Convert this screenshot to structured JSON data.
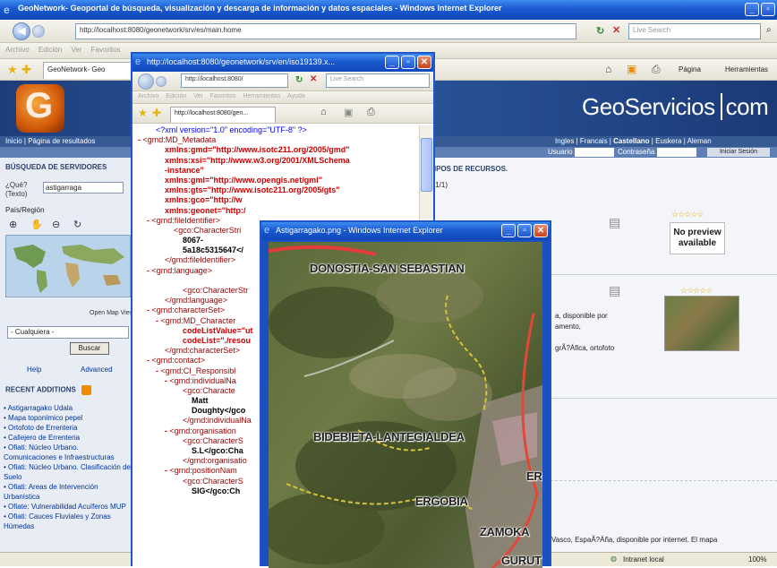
{
  "main_window": {
    "title": "GeoNetwork- Geoportal de búsqueda, visualización y descarga de información y datos espaciales - Windows Internet Explorer",
    "address": "http://localhost:8080/geonetwork/srv/es/main.home",
    "search_placeholder": "Live Search",
    "menu": [
      "Archivo",
      "Edición",
      "Ver",
      "Favoritos"
    ],
    "tab_label": "GeoNetwork- Geo",
    "page_menu": "Página",
    "tools_menu": "Herramientas"
  },
  "site": {
    "brand": "GeoServicios",
    "brand_suffix": "com",
    "nav_left": "Inicio | Página de resultados",
    "langs": [
      "Ingles",
      "Francais",
      "Castellano",
      "Euskera",
      "Aleman"
    ],
    "user_label": "Usuario",
    "password_label": "Contraseña",
    "login_button": "Iniciar Sesión",
    "search_header": "BÚSQUEDA DE SERVIDORES",
    "what_label": "¿Qué? (Texto)",
    "what_value": "astigarraga",
    "region_label": "País/Región",
    "map_caption": "Open Map Viewer",
    "region_select": "- Cualquiera -",
    "search_button": "Buscar",
    "help_link": "Help",
    "advanced_link": "Advanced",
    "recent_header": "RECENT ADDITIONS",
    "recent_items": [
      "Astigarragako Udala",
      "Mapa toponímico pepel",
      "Ortofoto de Errenteria",
      "Callejero de Errenteria",
      "Ofiati: Núcleo Urbano. Comunicaciones e Infraestructuras",
      "Ofiati: Núcleo Urbano. Clasificación del Suelo",
      "Ofiati: Areas de Intervención Urbanística",
      "Ofiate: Vulnerabilidad Acuíferos MUP",
      "Ofiati: Cauces Fluviales y Zonas Húmedas"
    ],
    "results_header": "TIPOS DE RECURSOS.",
    "results_pager": "s 1/1)",
    "no_preview": "No preview available",
    "result_text_1": "a, disponible por",
    "result_text_2": "amento,",
    "result_text_3": "grÃ?Áfica, ortofoto",
    "footer_text": "Vasco, EspaÃ?Áña, disponible por internet. El mapa",
    "status_zone": "Intranet local",
    "zoom": "100%"
  },
  "xml_window": {
    "title": "http://localhost:8080/geonetwork/srv/en/iso19139.x...",
    "address": "http://localhost:8080/",
    "search_placeholder": "Live Search",
    "menu": [
      "Archivo",
      "Edición",
      "Ver",
      "Favoritos",
      "Herramientas",
      "Ayuda"
    ],
    "tab_label": "http://localhost:8080/gen...",
    "lines": [
      {
        "indent": 1,
        "dash": false,
        "text": "<?xml version=\"1.0\" encoding=\"UTF-8\" ?>",
        "kind": "pi"
      },
      {
        "indent": 0,
        "dash": true,
        "text": "<gmd:MD_Metadata",
        "kind": "tag"
      },
      {
        "indent": 2,
        "dash": false,
        "text": "xmlns:gmd=\"http://www.isotc211.org/2005/gmd\"",
        "kind": "attr"
      },
      {
        "indent": 2,
        "dash": false,
        "text": "xmlns:xsi=\"http://www.w3.org/2001/XMLSchema",
        "kind": "attr"
      },
      {
        "indent": 2,
        "dash": false,
        "text": "-instance\"",
        "kind": "attr"
      },
      {
        "indent": 2,
        "dash": false,
        "text": "xmlns:gml=\"http://www.opengis.net/gml\"",
        "kind": "attr"
      },
      {
        "indent": 2,
        "dash": false,
        "text": "xmlns:gts=\"http://www.isotc211.org/2005/gts\"",
        "kind": "attr"
      },
      {
        "indent": 2,
        "dash": false,
        "text": "xmlns:gco=\"http://w",
        "kind": "attr"
      },
      {
        "indent": 2,
        "dash": false,
        "text": "xmlns:geonet=\"http:/",
        "kind": "attr"
      },
      {
        "indent": 1,
        "dash": true,
        "text": "<gmd:fileIdentifier>",
        "kind": "tag"
      },
      {
        "indent": 3,
        "dash": false,
        "text": "<gco:CharacterStri",
        "kind": "tag"
      },
      {
        "indent": 4,
        "dash": false,
        "text": "8067-",
        "kind": "txt"
      },
      {
        "indent": 4,
        "dash": false,
        "text": "5a18c5315647</",
        "kind": "txt"
      },
      {
        "indent": 2,
        "dash": false,
        "text": "</gmd:fileIdentifier>",
        "kind": "tag"
      },
      {
        "indent": 1,
        "dash": true,
        "text": "<gmd:language>",
        "kind": "tag"
      },
      {
        "indent": 0,
        "dash": false,
        "text": "",
        "kind": "txt"
      },
      {
        "indent": 4,
        "dash": false,
        "text": "<gco:CharacterStr",
        "kind": "tag"
      },
      {
        "indent": 2,
        "dash": false,
        "text": "</gmd:language>",
        "kind": "tag"
      },
      {
        "indent": 1,
        "dash": true,
        "text": "<gmd:characterSet>",
        "kind": "tag"
      },
      {
        "indent": 2,
        "dash": true,
        "text": "<gmd:MD_Character",
        "kind": "tag"
      },
      {
        "indent": 4,
        "dash": false,
        "text": "codeListValue=\"ut",
        "kind": "attr"
      },
      {
        "indent": 4,
        "dash": false,
        "text": "codeList=\"./resou",
        "kind": "attr"
      },
      {
        "indent": 2,
        "dash": false,
        "text": "</gmd:characterSet>",
        "kind": "tag"
      },
      {
        "indent": 1,
        "dash": true,
        "text": "<gmd:contact>",
        "kind": "tag"
      },
      {
        "indent": 2,
        "dash": true,
        "text": "<gmd:CI_Responsibl",
        "kind": "tag"
      },
      {
        "indent": 3,
        "dash": true,
        "text": "<gmd:individualNa",
        "kind": "tag"
      },
      {
        "indent": 4,
        "dash": false,
        "text": "<gco:Characte",
        "kind": "tag"
      },
      {
        "indent": 5,
        "dash": false,
        "text": "Matt",
        "kind": "txt"
      },
      {
        "indent": 5,
        "dash": false,
        "text": "Doughty</gco",
        "kind": "txt"
      },
      {
        "indent": 4,
        "dash": false,
        "text": "</gmd:individualNa",
        "kind": "tag"
      },
      {
        "indent": 3,
        "dash": true,
        "text": "<gmd:organisation",
        "kind": "tag"
      },
      {
        "indent": 4,
        "dash": false,
        "text": "<gco:CharacterS",
        "kind": "tag"
      },
      {
        "indent": 5,
        "dash": false,
        "text": "S.L</gco:Cha",
        "kind": "txt"
      },
      {
        "indent": 4,
        "dash": false,
        "text": "</gmd:organisatio",
        "kind": "tag"
      },
      {
        "indent": 3,
        "dash": true,
        "text": "<gmd:positionNam",
        "kind": "tag"
      },
      {
        "indent": 4,
        "dash": false,
        "text": "<gco:CharacterS",
        "kind": "tag"
      },
      {
        "indent": 5,
        "dash": false,
        "text": "SIG</gco:Ch",
        "kind": "txt"
      }
    ]
  },
  "image_window": {
    "title": "Astigarragako.png - Windows Internet Explorer",
    "labels": {
      "donostia": "DONOSTIA-SAN SEBASTIAN",
      "bidebieta": "BIDEBIETA-LANTEGIALDEA",
      "ergobia": "ERGOBIA",
      "zamoka": "ZAMOKA",
      "gurut": "GURUT",
      "er": "ER"
    }
  }
}
